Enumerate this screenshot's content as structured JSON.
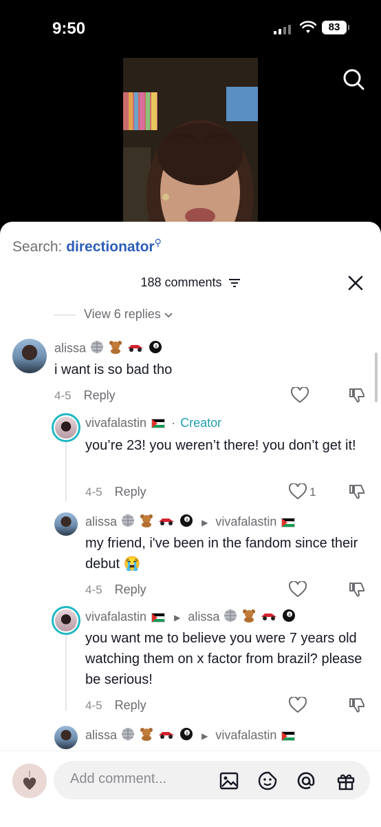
{
  "status_bar": {
    "time": "9:50",
    "battery": "83"
  },
  "sheet": {
    "search_label": "Search:",
    "search_term": "directionator",
    "comment_count": "188 comments",
    "view_replies": "View 6 replies"
  },
  "comments": [
    {
      "username": "alissa",
      "text": "i want is so bad tho",
      "date": "4-5",
      "reply_label": "Reply",
      "likes": ""
    },
    {
      "username": "vivafalastin",
      "badge": "Creator",
      "text": "you’re 23! you weren’t there! you don’t get it!",
      "date": "4-5",
      "reply_label": "Reply",
      "likes": "1"
    },
    {
      "username": "alissa",
      "reply_to": "vivafalastin",
      "text": "my friend, i've been in the fandom since their debut 😭",
      "date": "4-5",
      "reply_label": "Reply",
      "likes": ""
    },
    {
      "username": "vivafalastin",
      "reply_to": "alissa",
      "text": "you want me to believe you were 7 years old watching them on x factor from brazil? please be serious!",
      "date": "4-5",
      "reply_label": "Reply",
      "likes": ""
    },
    {
      "username": "alissa",
      "reply_to": "vivafalastin",
      "text": "",
      "date": "",
      "reply_label": "",
      "likes": ""
    }
  ],
  "composer": {
    "placeholder": "Add comment..."
  },
  "icons": [
    "search-icon",
    "filter-icon",
    "close-icon",
    "heart-icon",
    "dislike-icon",
    "image-icon",
    "sticker-icon",
    "mention-icon",
    "gift-icon"
  ],
  "colors": {
    "link_blue": "#2b5db8",
    "creator_teal": "#1e9fb0",
    "sheet_bg": "#ffffff"
  }
}
